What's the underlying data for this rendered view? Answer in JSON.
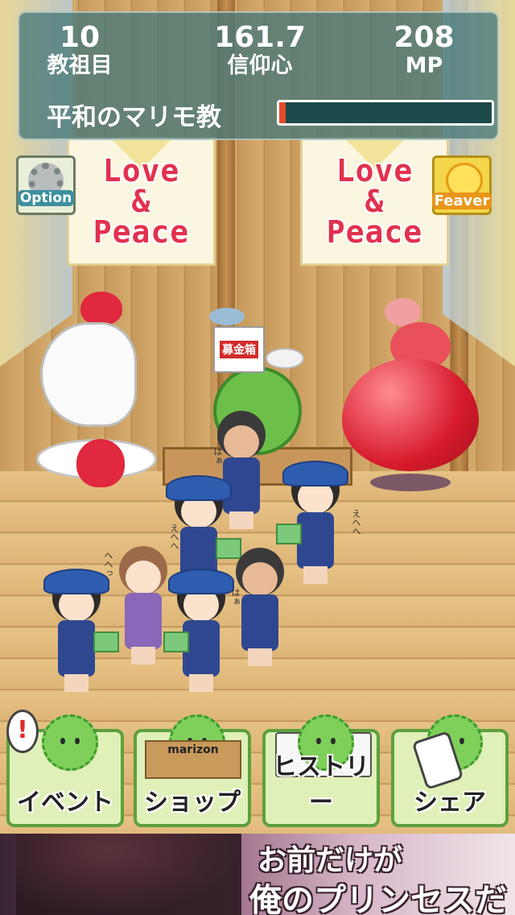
{
  "hud": {
    "generation_value": "10",
    "generation_label": "教祖目",
    "faith_value": "161.7",
    "faith_label": "信仰心",
    "mp_value": "208",
    "mp_label": "MP",
    "religion_name": "平和のマリモ教",
    "progress_fraction": 0.03
  },
  "banners": {
    "left_line1": "Love",
    "left_line2": "&",
    "left_line3": "Peace",
    "right_line1": "Love",
    "right_line2": "&",
    "right_line3": "Peace"
  },
  "corner_buttons": {
    "option_label": "Option",
    "feaver_label": "Feaver"
  },
  "scene": {
    "donation_box_label": "募金箱",
    "mutters": [
      "はぁ",
      "えへへ",
      "えへへ",
      "へへっ",
      "はぁ"
    ]
  },
  "menu": {
    "event_label": "イベント",
    "event_alert": "!",
    "shop_label": "ショップ",
    "shop_box_text": "marizon",
    "history_label": "ヒストリー",
    "share_label": "シェア"
  },
  "ad": {
    "line1": "お前だけが",
    "line2": "俺のプリンセスだ"
  },
  "colors": {
    "hud_bg": "#46787a",
    "progress_fill": "#e84a2c",
    "banner_text": "#e2314e",
    "menu_green": "#5da03d"
  }
}
